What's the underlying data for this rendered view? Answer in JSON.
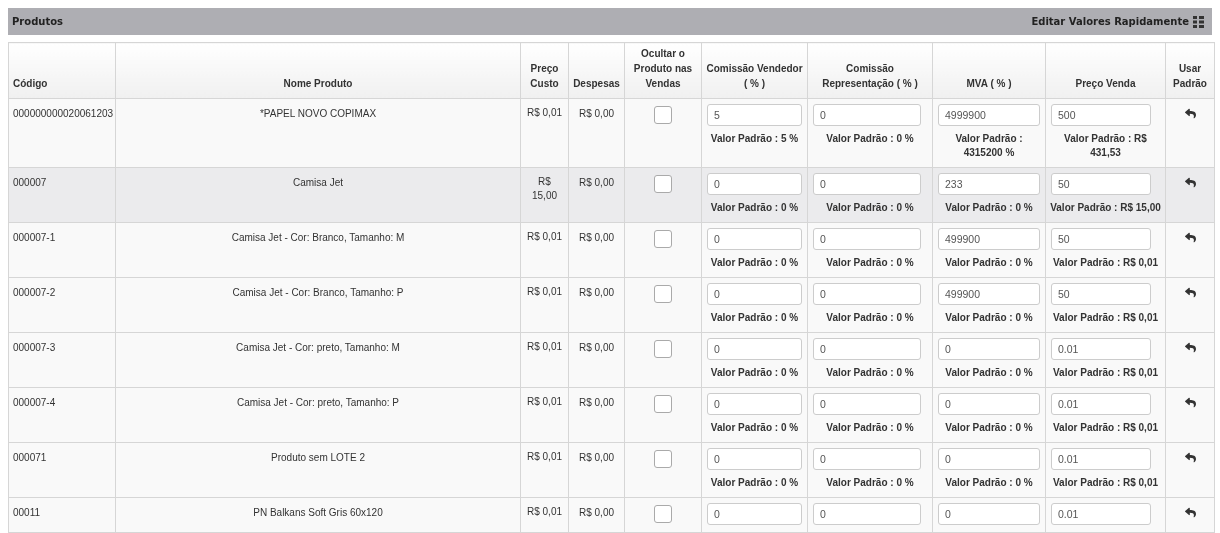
{
  "panel": {
    "title": "Produtos",
    "quick_edit": "Editar Valores Rapidamente"
  },
  "table": {
    "columns": [
      "Código",
      "Nome Produto",
      "Preço Custo",
      "Despesas",
      "Ocultar o Produto nas Vendas",
      "Comissão Vendedor ( % )",
      "Comissão Representação ( % )",
      "MVA ( % )",
      "Preço Venda",
      "Usar Padrão"
    ],
    "rows": [
      {
        "code": "000000000020061203",
        "name": "*PAPEL NOVO COPIMAX",
        "cost": "R$ 0,01",
        "expenses": "R$ 0,00",
        "hide_in_sales": false,
        "highlighted": false,
        "fields": [
          {
            "value": "5",
            "default": "Valor Padrão : 5 %"
          },
          {
            "value": "0",
            "default": "Valor Padrão : 0 %"
          },
          {
            "value": "4999900",
            "default": "Valor Padrão : 4315200 %"
          },
          {
            "value": "500",
            "default": "Valor Padrão : R$ 431,53"
          }
        ]
      },
      {
        "code": "000007",
        "name": "Camisa Jet",
        "cost": "R$ 15,00",
        "expenses": "R$ 0,00",
        "hide_in_sales": false,
        "highlighted": true,
        "fields": [
          {
            "value": "0",
            "default": "Valor Padrão : 0 %"
          },
          {
            "value": "0",
            "default": "Valor Padrão : 0 %"
          },
          {
            "value": "233",
            "default": "Valor Padrão : 0 %"
          },
          {
            "value": "50",
            "default": "Valor Padrão : R$ 15,00"
          }
        ]
      },
      {
        "code": "000007-1",
        "name": "Camisa Jet - Cor: Branco, Tamanho: M",
        "cost": "R$ 0,01",
        "expenses": "R$ 0,00",
        "hide_in_sales": false,
        "highlighted": false,
        "fields": [
          {
            "value": "0",
            "default": "Valor Padrão : 0 %"
          },
          {
            "value": "0",
            "default": "Valor Padrão : 0 %"
          },
          {
            "value": "499900",
            "default": "Valor Padrão : 0 %"
          },
          {
            "value": "50",
            "default": "Valor Padrão : R$ 0,01"
          }
        ]
      },
      {
        "code": "000007-2",
        "name": "Camisa Jet - Cor: Branco, Tamanho: P",
        "cost": "R$ 0,01",
        "expenses": "R$ 0,00",
        "hide_in_sales": false,
        "highlighted": false,
        "fields": [
          {
            "value": "0",
            "default": "Valor Padrão : 0 %"
          },
          {
            "value": "0",
            "default": "Valor Padrão : 0 %"
          },
          {
            "value": "499900",
            "default": "Valor Padrão : 0 %"
          },
          {
            "value": "50",
            "default": "Valor Padrão : R$ 0,01"
          }
        ]
      },
      {
        "code": "000007-3",
        "name": "Camisa Jet - Cor: preto, Tamanho: M",
        "cost": "R$ 0,01",
        "expenses": "R$ 0,00",
        "hide_in_sales": false,
        "highlighted": false,
        "fields": [
          {
            "value": "0",
            "default": "Valor Padrão : 0 %"
          },
          {
            "value": "0",
            "default": "Valor Padrão : 0 %"
          },
          {
            "value": "0",
            "default": "Valor Padrão : 0 %"
          },
          {
            "value": "0.01",
            "default": "Valor Padrão : R$ 0,01"
          }
        ]
      },
      {
        "code": "000007-4",
        "name": "Camisa Jet - Cor: preto, Tamanho: P",
        "cost": "R$ 0,01",
        "expenses": "R$ 0,00",
        "hide_in_sales": false,
        "highlighted": false,
        "fields": [
          {
            "value": "0",
            "default": "Valor Padrão : 0 %"
          },
          {
            "value": "0",
            "default": "Valor Padrão : 0 %"
          },
          {
            "value": "0",
            "default": "Valor Padrão : 0 %"
          },
          {
            "value": "0.01",
            "default": "Valor Padrão : R$ 0,01"
          }
        ]
      },
      {
        "code": "000071",
        "name": "Produto sem LOTE 2",
        "cost": "R$ 0,01",
        "expenses": "R$ 0,00",
        "hide_in_sales": false,
        "highlighted": false,
        "fields": [
          {
            "value": "0",
            "default": "Valor Padrão : 0 %"
          },
          {
            "value": "0",
            "default": "Valor Padrão : 0 %"
          },
          {
            "value": "0",
            "default": "Valor Padrão : 0 %"
          },
          {
            "value": "0.01",
            "default": "Valor Padrão : R$ 0,01"
          }
        ]
      },
      {
        "code": "00011",
        "name": "PN Balkans Soft Gris 60x120",
        "cost": "R$ 0,01",
        "expenses": "R$ 0,00",
        "hide_in_sales": false,
        "highlighted": false,
        "fields": [
          {
            "value": "0"
          },
          {
            "value": "0"
          },
          {
            "value": "0"
          },
          {
            "value": "0.01"
          }
        ]
      }
    ]
  }
}
